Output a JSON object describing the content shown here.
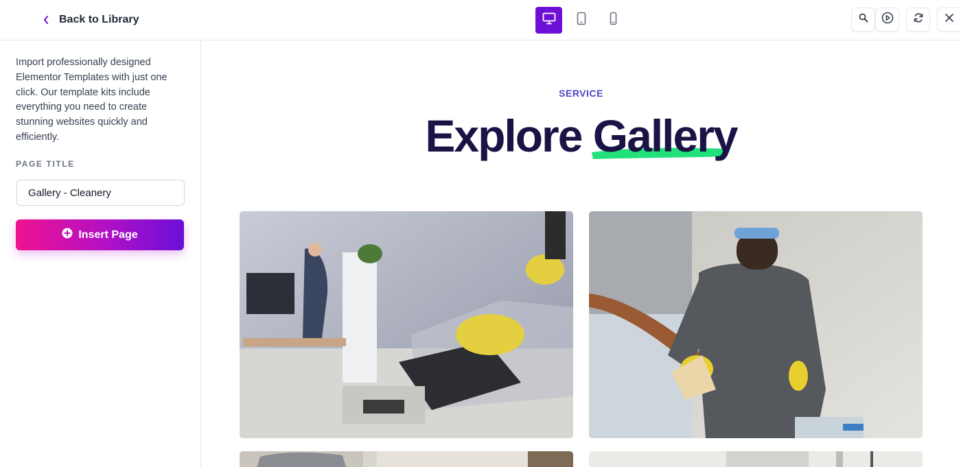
{
  "header": {
    "back_label": "Back to Library",
    "devices": [
      {
        "name": "desktop",
        "active": true
      },
      {
        "name": "tablet",
        "active": false
      },
      {
        "name": "mobile",
        "active": false
      }
    ]
  },
  "sidebar": {
    "description": "Import professionally designed Elementor Templates with just one click. Our template kits include everything you need to create stunning websites quickly and efficiently.",
    "page_title_label": "PAGE TITLE",
    "page_title_value": "Gallery - Cleanery",
    "insert_label": "Insert Page"
  },
  "preview": {
    "eyebrow": "SERVICE",
    "headline_part1": "Explore",
    "headline_part2": "Gallery"
  },
  "colors": {
    "accent": "#6d10d6",
    "gradient_start": "#f0128f",
    "gradient_end": "#6a0fd6",
    "eyebrow": "#4f46c9",
    "headline": "#1a1446",
    "highlight": "#22e07a"
  }
}
